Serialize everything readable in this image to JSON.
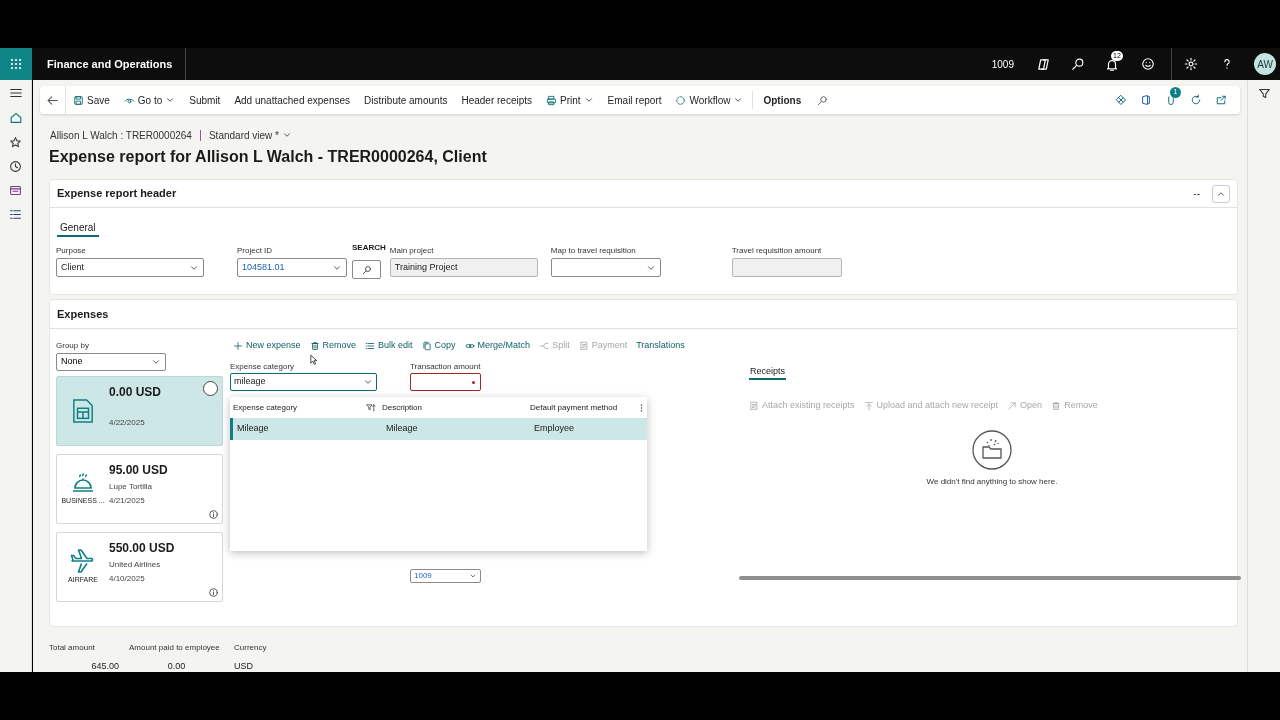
{
  "app_bar": {
    "title": "Finance and Operations",
    "company": "1009",
    "notification_count": "12",
    "avatar": "AW"
  },
  "action_pane": {
    "items": [
      {
        "label": "Save",
        "menu": false
      },
      {
        "label": "Go to",
        "menu": true
      },
      {
        "label": "Submit",
        "menu": false
      },
      {
        "label": "Add unattached expenses",
        "menu": false
      },
      {
        "label": "Distribute amounts",
        "menu": false
      },
      {
        "label": "Header receipts",
        "menu": false
      },
      {
        "label": "Print",
        "menu": true
      },
      {
        "label": "Email report",
        "menu": false
      },
      {
        "label": "Workflow",
        "menu": true
      }
    ],
    "options": "Options",
    "attachment_count": "1"
  },
  "breadcrumb": {
    "record": "Allison L Walch : TRER0000264",
    "view": "Standard view *"
  },
  "page_title": "Expense report for Allison L Walch - TRER0000264, Client",
  "header_section": {
    "title": "Expense report header",
    "collapse_label": "--",
    "tabs": [
      {
        "label": "General",
        "selected": true
      }
    ],
    "fields": [
      {
        "kind": "select",
        "label": "Purpose",
        "value": "Client",
        "link": false
      },
      {
        "kind": "select",
        "label": "Project ID",
        "value": "104581.01",
        "link": true
      },
      {
        "kind": "search",
        "label": "SEARCH"
      },
      {
        "kind": "readonly",
        "label": "Main project",
        "value": "Training Project"
      },
      {
        "kind": "select",
        "label": "Map to travel requisition"
      },
      {
        "kind": "readonly",
        "label": "Travel requisition amount"
      }
    ]
  },
  "expenses_section": {
    "title": "Expenses",
    "group_by": {
      "label": "Group by",
      "value": "None"
    },
    "toolbar": [
      {
        "label": "New expense",
        "disabled": false
      },
      {
        "label": "Remove",
        "disabled": false
      },
      {
        "label": "Bulk edit",
        "disabled": false
      },
      {
        "label": "Copy",
        "disabled": false
      },
      {
        "label": "Merge/Match",
        "disabled": false
      },
      {
        "label": "Split",
        "disabled": true
      },
      {
        "label": "Payment",
        "disabled": true
      },
      {
        "label": "Translations",
        "disabled": false
      }
    ],
    "cards": [
      {
        "kind": "report",
        "amount": "0.00 USD",
        "date": "4/22/2025",
        "selected": true,
        "info": false
      },
      {
        "kind": "meal",
        "amount": "95.00 USD",
        "merchant": "Lupe Tortilla",
        "date": "4/21/2025",
        "category": "BUSINESS ...",
        "selected": false,
        "info": true
      },
      {
        "kind": "airfare",
        "amount": "550.00 USD",
        "merchant": "United Airlines",
        "date": "4/10/2025",
        "category": "AIRFARE",
        "selected": false,
        "info": true
      }
    ],
    "form": {
      "category": {
        "label": "Expense category",
        "value": "mileage"
      },
      "amount": {
        "label": "Transaction amount",
        "required": true
      },
      "partly_hidden_value": "1009"
    },
    "lookup": {
      "columns": [
        "Expense category",
        "Description",
        "Default payment method"
      ],
      "rows": [
        {
          "cells": [
            "Mileage",
            "Mileage",
            "Employee"
          ],
          "selected": true
        }
      ]
    },
    "receipts": {
      "tabs": [
        {
          "label": "Receipts",
          "selected": true
        }
      ],
      "toolbar": [
        {
          "label": "Attach existing receipts",
          "disabled": true
        },
        {
          "label": "Upload and attach new receipt",
          "disabled": true
        },
        {
          "label": "Open",
          "disabled": true
        },
        {
          "label": "Remove",
          "disabled": true
        }
      ],
      "empty_message": "We didn't find anything to show here."
    }
  },
  "totals": [
    {
      "label": "Total amount",
      "value": "645.00"
    },
    {
      "label": "Amount paid to employee",
      "value": "0.00"
    },
    {
      "label": "Currency",
      "value": "USD"
    }
  ]
}
